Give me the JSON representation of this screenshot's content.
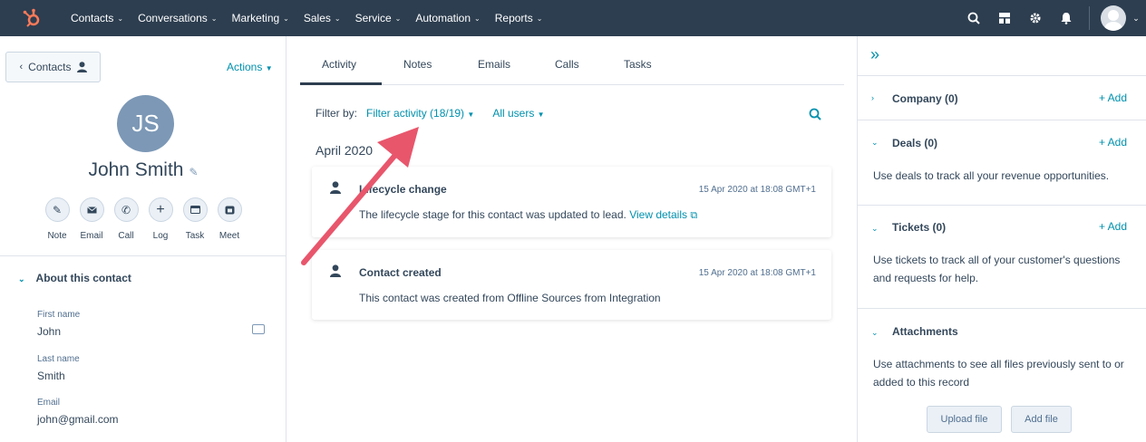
{
  "topnav": {
    "items": [
      "Contacts",
      "Conversations",
      "Marketing",
      "Sales",
      "Service",
      "Automation",
      "Reports"
    ],
    "icons": [
      "search-icon",
      "marketplace-icon",
      "settings-icon",
      "notifications-icon",
      "user-avatar"
    ]
  },
  "left": {
    "back_label": "Contacts",
    "actions_label": "Actions",
    "initials": "JS",
    "name": "John Smith",
    "action_buttons": [
      "Note",
      "Email",
      "Call",
      "Log",
      "Task",
      "Meet"
    ],
    "about_title": "About this contact",
    "fields": [
      {
        "label": "First name",
        "value": "John"
      },
      {
        "label": "Last name",
        "value": "Smith"
      },
      {
        "label": "Email",
        "value": "john@gmail.com"
      }
    ]
  },
  "center": {
    "tabs": [
      "Activity",
      "Notes",
      "Emails",
      "Calls",
      "Tasks"
    ],
    "filter_by": "Filter by:",
    "filter_activity": "Filter activity (18/19)",
    "all_users": "All users",
    "month": "April 2020",
    "cards": [
      {
        "title": "Lifecycle change",
        "date": "15 Apr 2020 at 18:08 GMT+1",
        "body": "The lifecycle stage for this contact was updated to lead.",
        "link": "View details"
      },
      {
        "title": "Contact created",
        "date": "15 Apr 2020 at 18:08 GMT+1",
        "body": "This contact was created from Offline Sources from Integration",
        "link": ""
      }
    ]
  },
  "right": {
    "company": {
      "title": "Company (0)",
      "add": "+ Add"
    },
    "deals": {
      "title": "Deals (0)",
      "add": "+ Add",
      "desc": "Use deals to track all your revenue opportunities."
    },
    "tickets": {
      "title": "Tickets (0)",
      "add": "+ Add",
      "desc": "Use tickets to track all of your customer's questions and requests for help."
    },
    "attachments": {
      "title": "Attachments",
      "desc": "Use attachments to see all files previously sent to or added to this record",
      "upload": "Upload file",
      "addfile": "Add file"
    }
  },
  "colors": {
    "nav": "#2d3e50",
    "link": "#0091ae",
    "annotation_arrow": "#e8566c"
  }
}
